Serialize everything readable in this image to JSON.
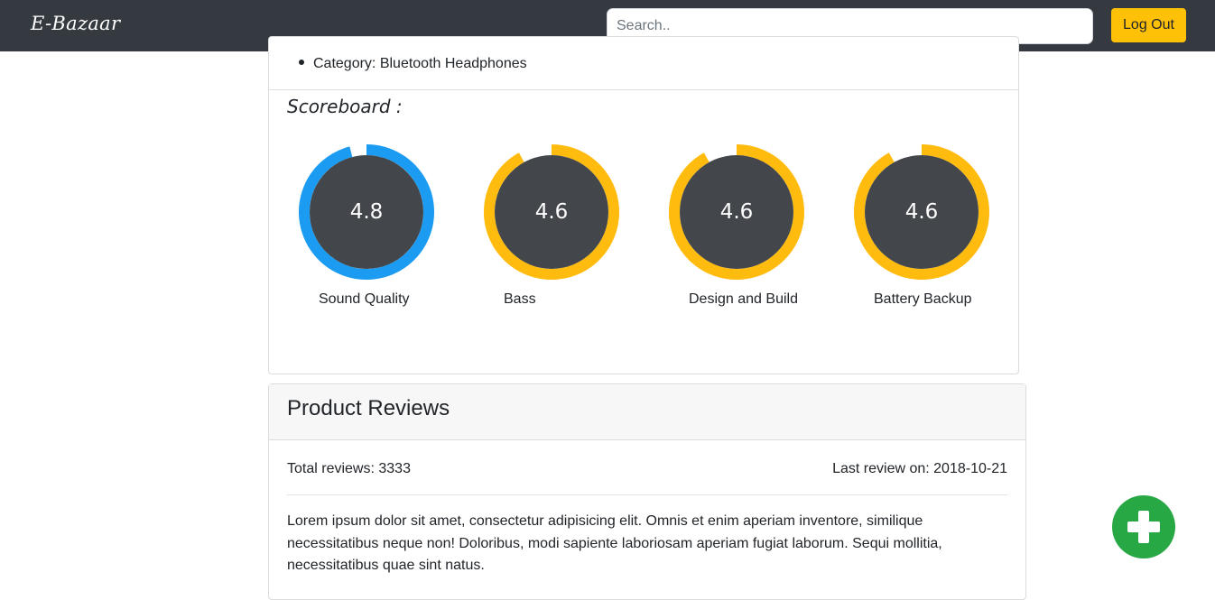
{
  "navbar": {
    "brand": "E-Bazaar",
    "search_placeholder": "Search..",
    "logout_label": "Log Out"
  },
  "product": {
    "category_label": "Category: Bluetooth Headphones"
  },
  "scoreboard": {
    "title": "Scoreboard :",
    "max_score": 5,
    "items": [
      {
        "label": "Sound Quality",
        "value": "4.8",
        "score": 4.8,
        "color": "#1b9cf2"
      },
      {
        "label": "Bass",
        "value": "4.6",
        "score": 4.6,
        "color": "#ffbb0e"
      },
      {
        "label": "Design and Build",
        "value": "4.6",
        "score": 4.6,
        "color": "#ffbb0e"
      },
      {
        "label": "Battery Backup",
        "value": "4.6",
        "score": 4.6,
        "color": "#ffbb0e"
      }
    ]
  },
  "reviews": {
    "title": "Product Reviews",
    "total": "Total reviews: 3333",
    "last": "Last review on: 2018-10-21",
    "text": "Lorem ipsum dolor sit amet, consectetur adipisicing elit. Omnis et enim aperiam inventore, similique necessitatibus neque non! Doloribus, modi sapiente laboriosam aperiam fugiat laborum. Sequi mollitia, necessitatibus quae sint natus."
  },
  "colors": {
    "navbar": "#343a40",
    "gauge_inner": "#43464a",
    "logout": "#ffc107",
    "fab": "#28a745"
  },
  "fab": {
    "icon": "plus-icon"
  }
}
